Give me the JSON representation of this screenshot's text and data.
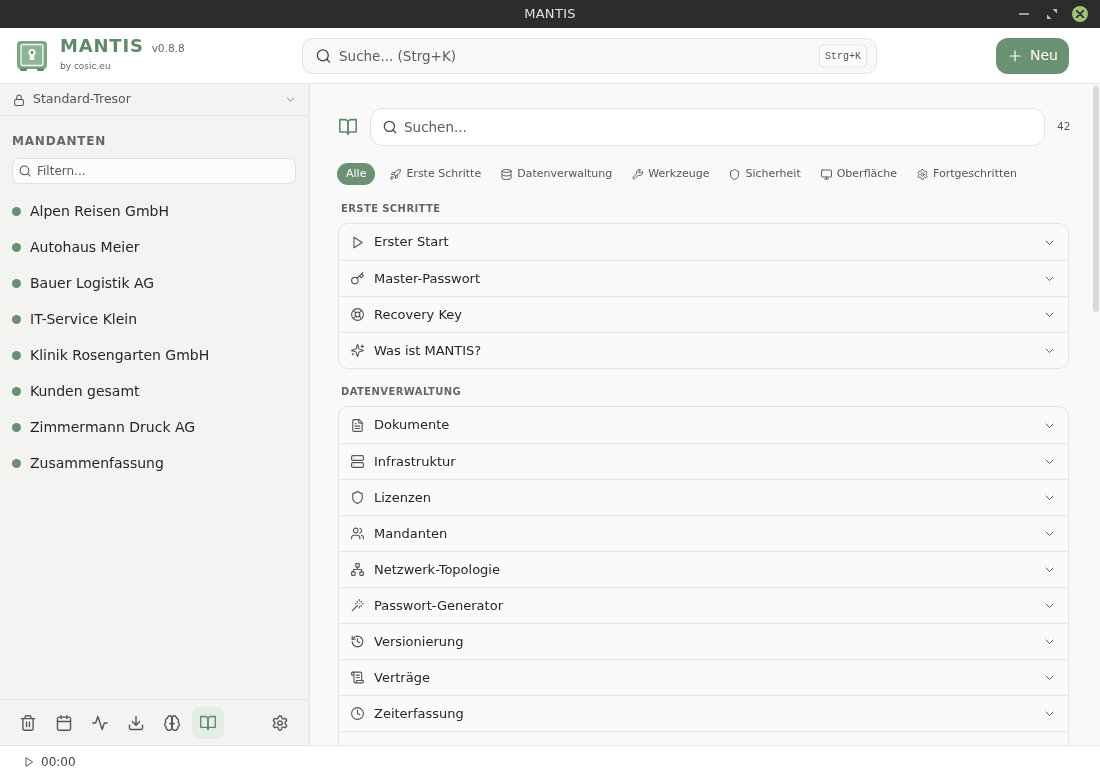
{
  "window": {
    "title": "MANTIS"
  },
  "header": {
    "app_name": "MANTIS",
    "version": "v0.8.8",
    "byline": "by cosic.eu",
    "search": {
      "placeholder": "Suche... (Strg+K)",
      "shortcut": "Strg+K"
    },
    "new_button": {
      "label": "Neu"
    }
  },
  "sidebar": {
    "vault": {
      "label": "Standard-Tresor"
    },
    "section_title": "MANDANTEN",
    "filter": {
      "placeholder": "Filtern..."
    },
    "clients": [
      {
        "name": "Alpen Reisen GmbH"
      },
      {
        "name": "Autohaus Meier"
      },
      {
        "name": "Bauer Logistik AG"
      },
      {
        "name": "IT-Service Klein"
      },
      {
        "name": "Klinik Rosengarten GmbH"
      },
      {
        "name": "Kunden gesamt"
      },
      {
        "name": "Zimmermann Druck AG"
      },
      {
        "name": "Zusammenfassung"
      }
    ],
    "toolbar": [
      {
        "kind": "trash",
        "selected": false
      },
      {
        "kind": "calendar",
        "selected": false
      },
      {
        "kind": "activity",
        "selected": false
      },
      {
        "kind": "download",
        "selected": false
      },
      {
        "kind": "brain",
        "selected": false
      },
      {
        "kind": "book",
        "selected": true
      },
      {
        "kind": "settings",
        "selected": false
      }
    ]
  },
  "main": {
    "search": {
      "placeholder": "Suchen..."
    },
    "result_count": "42",
    "categories": [
      {
        "kind": "all",
        "label": "Alle",
        "selected": true
      },
      {
        "kind": "rocket",
        "label": "Erste Schritte",
        "selected": false
      },
      {
        "kind": "database",
        "label": "Datenverwaltung",
        "selected": false
      },
      {
        "kind": "wrench",
        "label": "Werkzeuge",
        "selected": false
      },
      {
        "kind": "shield",
        "label": "Sicherheit",
        "selected": false
      },
      {
        "kind": "monitor",
        "label": "Oberfläche",
        "selected": false
      },
      {
        "kind": "settings",
        "label": "Fortgeschritten",
        "selected": false
      }
    ],
    "sections": [
      {
        "title": "ERSTE SCHRITTE",
        "cut_off": false,
        "items": [
          {
            "kind": "play",
            "label": "Erster Start",
            "expanded": false
          },
          {
            "kind": "key",
            "label": "Master-Passwort",
            "expanded": false
          },
          {
            "kind": "lifebuoy",
            "label": "Recovery Key",
            "expanded": false
          },
          {
            "kind": "sparkles",
            "label": "Was ist MANTIS?",
            "expanded": false
          }
        ]
      },
      {
        "title": "DATENVERWALTUNG",
        "cut_off": true,
        "items": [
          {
            "kind": "document",
            "label": "Dokumente",
            "expanded": false
          },
          {
            "kind": "server",
            "label": "Infrastruktur",
            "expanded": false
          },
          {
            "kind": "shield",
            "label": "Lizenzen",
            "expanded": false
          },
          {
            "kind": "users",
            "label": "Mandanten",
            "expanded": false
          },
          {
            "kind": "network",
            "label": "Netzwerk-Topologie",
            "expanded": false
          },
          {
            "kind": "wand",
            "label": "Passwort-Generator",
            "expanded": false
          },
          {
            "kind": "history",
            "label": "Versionierung",
            "expanded": false
          },
          {
            "kind": "scroll",
            "label": "Verträge",
            "expanded": false
          },
          {
            "kind": "clock",
            "label": "Zeiterfassung",
            "expanded": false
          }
        ]
      }
    ]
  },
  "status_bar": {
    "timer": "00:00"
  }
}
